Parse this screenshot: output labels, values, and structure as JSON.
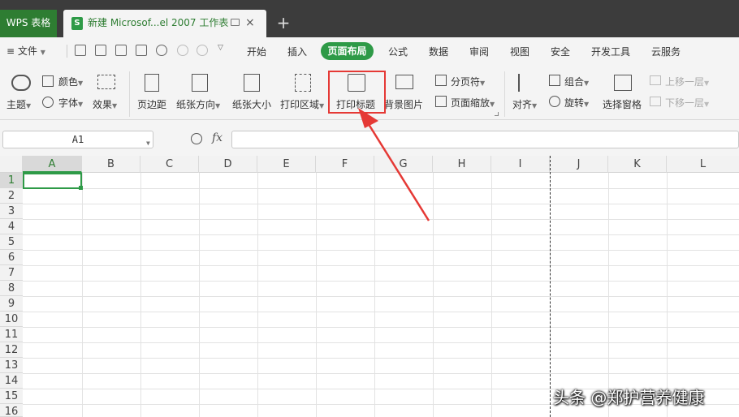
{
  "titlebar": {
    "app_tab": "WPS 表格",
    "doc_icon": "S",
    "doc_title": "新建 Microsof...el 2007 工作表",
    "close": "×",
    "new_tab": "+"
  },
  "menubar": {
    "file": "≡ 文件",
    "items": [
      "开始",
      "插入",
      "页面布局",
      "公式",
      "数据",
      "审阅",
      "视图",
      "安全",
      "开发工具",
      "云服务"
    ],
    "active": "页面布局"
  },
  "ribbon": {
    "theme": "主题",
    "color": "颜色",
    "font": "字体",
    "effect": "效果",
    "margins": "页边距",
    "orientation": "纸张方向",
    "size": "纸张大小",
    "print_area": "打印区域",
    "print_titles": "打印标题",
    "background": "背景图片",
    "page_break": "分页符",
    "page_zoom": "页面缩放",
    "align": "对齐",
    "group": "组合",
    "rotate": "旋转",
    "selection_pane": "选择窗格",
    "bring_forward": "上移一层",
    "send_backward": "下移一层"
  },
  "formula_bar": {
    "name_box": "A1",
    "fx": "fx",
    "value": ""
  },
  "sheet": {
    "columns": [
      "A",
      "B",
      "C",
      "D",
      "E",
      "F",
      "G",
      "H",
      "I",
      "J",
      "K",
      "L"
    ],
    "rows": [
      "1",
      "2",
      "3",
      "4",
      "5",
      "6",
      "7",
      "8",
      "9",
      "10",
      "11",
      "12",
      "13",
      "14",
      "15",
      "16"
    ],
    "selected_cell": "A1"
  },
  "watermark": "头条 @郑护营养健康",
  "colors": {
    "accent": "#2e9a47",
    "highlight": "#e53935"
  }
}
